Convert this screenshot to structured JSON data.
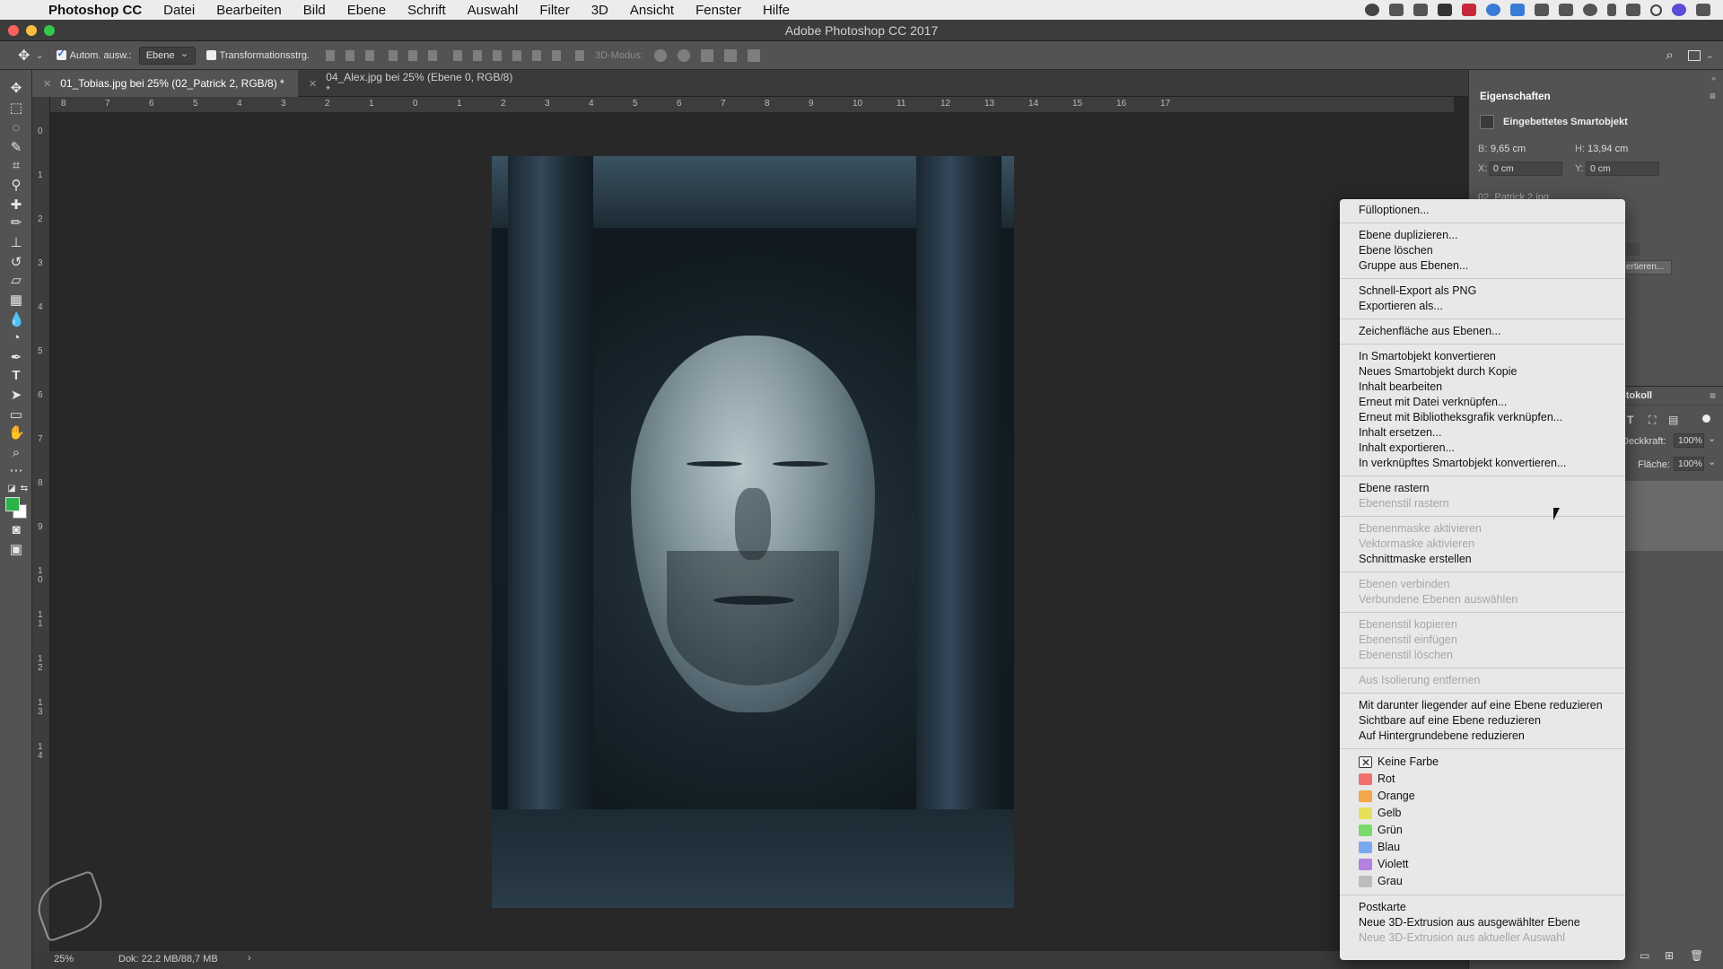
{
  "menubar": {
    "items": [
      "Photoshop CC",
      "Datei",
      "Bearbeiten",
      "Bild",
      "Ebene",
      "Schrift",
      "Auswahl",
      "Filter",
      "3D",
      "Ansicht",
      "Fenster",
      "Hilfe"
    ]
  },
  "window": {
    "title": "Adobe Photoshop CC 2017"
  },
  "options": {
    "auto_select_label": "Autom. ausw.:",
    "auto_select_value": "Ebene",
    "transform_label": "Transformationsstrg.",
    "mode3d_label": "3D-Modus:"
  },
  "tabs": [
    {
      "label": "01_Tobias.jpg bei 25% (02_Patrick 2, RGB/8) *",
      "active": true
    },
    {
      "label": "04_Alex.jpg bei 25% (Ebene 0, RGB/8) *",
      "active": false
    }
  ],
  "ruler_h": [
    "8",
    "7",
    "6",
    "5",
    "4",
    "3",
    "2",
    "1",
    "0",
    "1",
    "2",
    "3",
    "4",
    "5",
    "6",
    "7",
    "8",
    "9",
    "10",
    "11",
    "12",
    "13",
    "14",
    "15",
    "16",
    "17"
  ],
  "ruler_v": [
    "0",
    "1",
    "2",
    "3",
    "4",
    "5",
    "6",
    "7",
    "8",
    "9",
    "10",
    "11",
    "12",
    "13",
    "14"
  ],
  "status": {
    "zoom": "25%",
    "doc": "Dok: 22,2 MB/88,7 MB",
    "arrow": "›"
  },
  "properties": {
    "title": "Eigenschaften",
    "object_type": "Eingebettetes Smartobjekt",
    "w_label": "B:",
    "w_value": "9,65 cm",
    "h_label": "H:",
    "h_value": "13,94 cm",
    "x_label": "X:",
    "x_value": "0 cm",
    "y_label": "Y:",
    "y_value": "0 cm",
    "file": "02_Patrick 2.jpg",
    "convert_fragment": "ertieren..."
  },
  "layers": {
    "tab_fragment": "otokoll",
    "opacity_label": "Deckkraft:",
    "opacity_value": "100%",
    "fill_label": "Fläche:",
    "fill_value": "100%"
  },
  "context_menu": {
    "groups": [
      [
        {
          "label": "Fülloptionen...",
          "enabled": true
        }
      ],
      [
        {
          "label": "Ebene duplizieren...",
          "enabled": true
        },
        {
          "label": "Ebene löschen",
          "enabled": true
        },
        {
          "label": "Gruppe aus Ebenen...",
          "enabled": true
        }
      ],
      [
        {
          "label": "Schnell-Export als PNG",
          "enabled": true
        },
        {
          "label": "Exportieren als...",
          "enabled": true
        }
      ],
      [
        {
          "label": "Zeichenfläche aus Ebenen...",
          "enabled": true
        }
      ],
      [
        {
          "label": "In Smartobjekt konvertieren",
          "enabled": true
        },
        {
          "label": "Neues Smartobjekt durch Kopie",
          "enabled": true
        },
        {
          "label": "Inhalt bearbeiten",
          "enabled": true
        },
        {
          "label": "Erneut mit Datei verknüpfen...",
          "enabled": true
        },
        {
          "label": "Erneut mit Bibliotheksgrafik verknüpfen...",
          "enabled": true
        },
        {
          "label": "Inhalt ersetzen...",
          "enabled": true
        },
        {
          "label": "Inhalt exportieren...",
          "enabled": true
        },
        {
          "label": "In verknüpftes Smartobjekt konvertieren...",
          "enabled": true
        }
      ],
      [
        {
          "label": "Ebene rastern",
          "enabled": true
        },
        {
          "label": "Ebenenstil rastern",
          "enabled": false
        }
      ],
      [
        {
          "label": "Ebenenmaske aktivieren",
          "enabled": false
        },
        {
          "label": "Vektormaske aktivieren",
          "enabled": false
        },
        {
          "label": "Schnittmaske erstellen",
          "enabled": true
        }
      ],
      [
        {
          "label": "Ebenen verbinden",
          "enabled": false
        },
        {
          "label": "Verbundene Ebenen auswählen",
          "enabled": false
        }
      ],
      [
        {
          "label": "Ebenenstil kopieren",
          "enabled": false
        },
        {
          "label": "Ebenenstil einfügen",
          "enabled": false
        },
        {
          "label": "Ebenenstil löschen",
          "enabled": false
        }
      ],
      [
        {
          "label": "Aus Isolierung entfernen",
          "enabled": false
        }
      ],
      [
        {
          "label": "Mit darunter liegender auf eine Ebene reduzieren",
          "enabled": true
        },
        {
          "label": "Sichtbare auf eine Ebene reduzieren",
          "enabled": true
        },
        {
          "label": "Auf Hintergrundebene reduzieren",
          "enabled": true
        }
      ]
    ],
    "colors": [
      {
        "label": "Keine Farbe",
        "color": "none"
      },
      {
        "label": "Rot",
        "color": "#f07070"
      },
      {
        "label": "Orange",
        "color": "#f4a64a"
      },
      {
        "label": "Gelb",
        "color": "#e8e05a"
      },
      {
        "label": "Grün",
        "color": "#7cd96c"
      },
      {
        "label": "Blau",
        "color": "#7aa8f0"
      },
      {
        "label": "Violett",
        "color": "#b283e0"
      },
      {
        "label": "Grau",
        "color": "#bdbdbd"
      }
    ],
    "tail": [
      {
        "label": "Postkarte",
        "enabled": true
      },
      {
        "label": "Neue 3D-Extrusion aus ausgewählter Ebene",
        "enabled": true
      },
      {
        "label": "Neue 3D-Extrusion aus aktueller Auswahl",
        "enabled": false
      }
    ]
  },
  "colors": {
    "foreground": "#2bb34a",
    "background": "#ffffff",
    "accent": "#2a62d6"
  }
}
